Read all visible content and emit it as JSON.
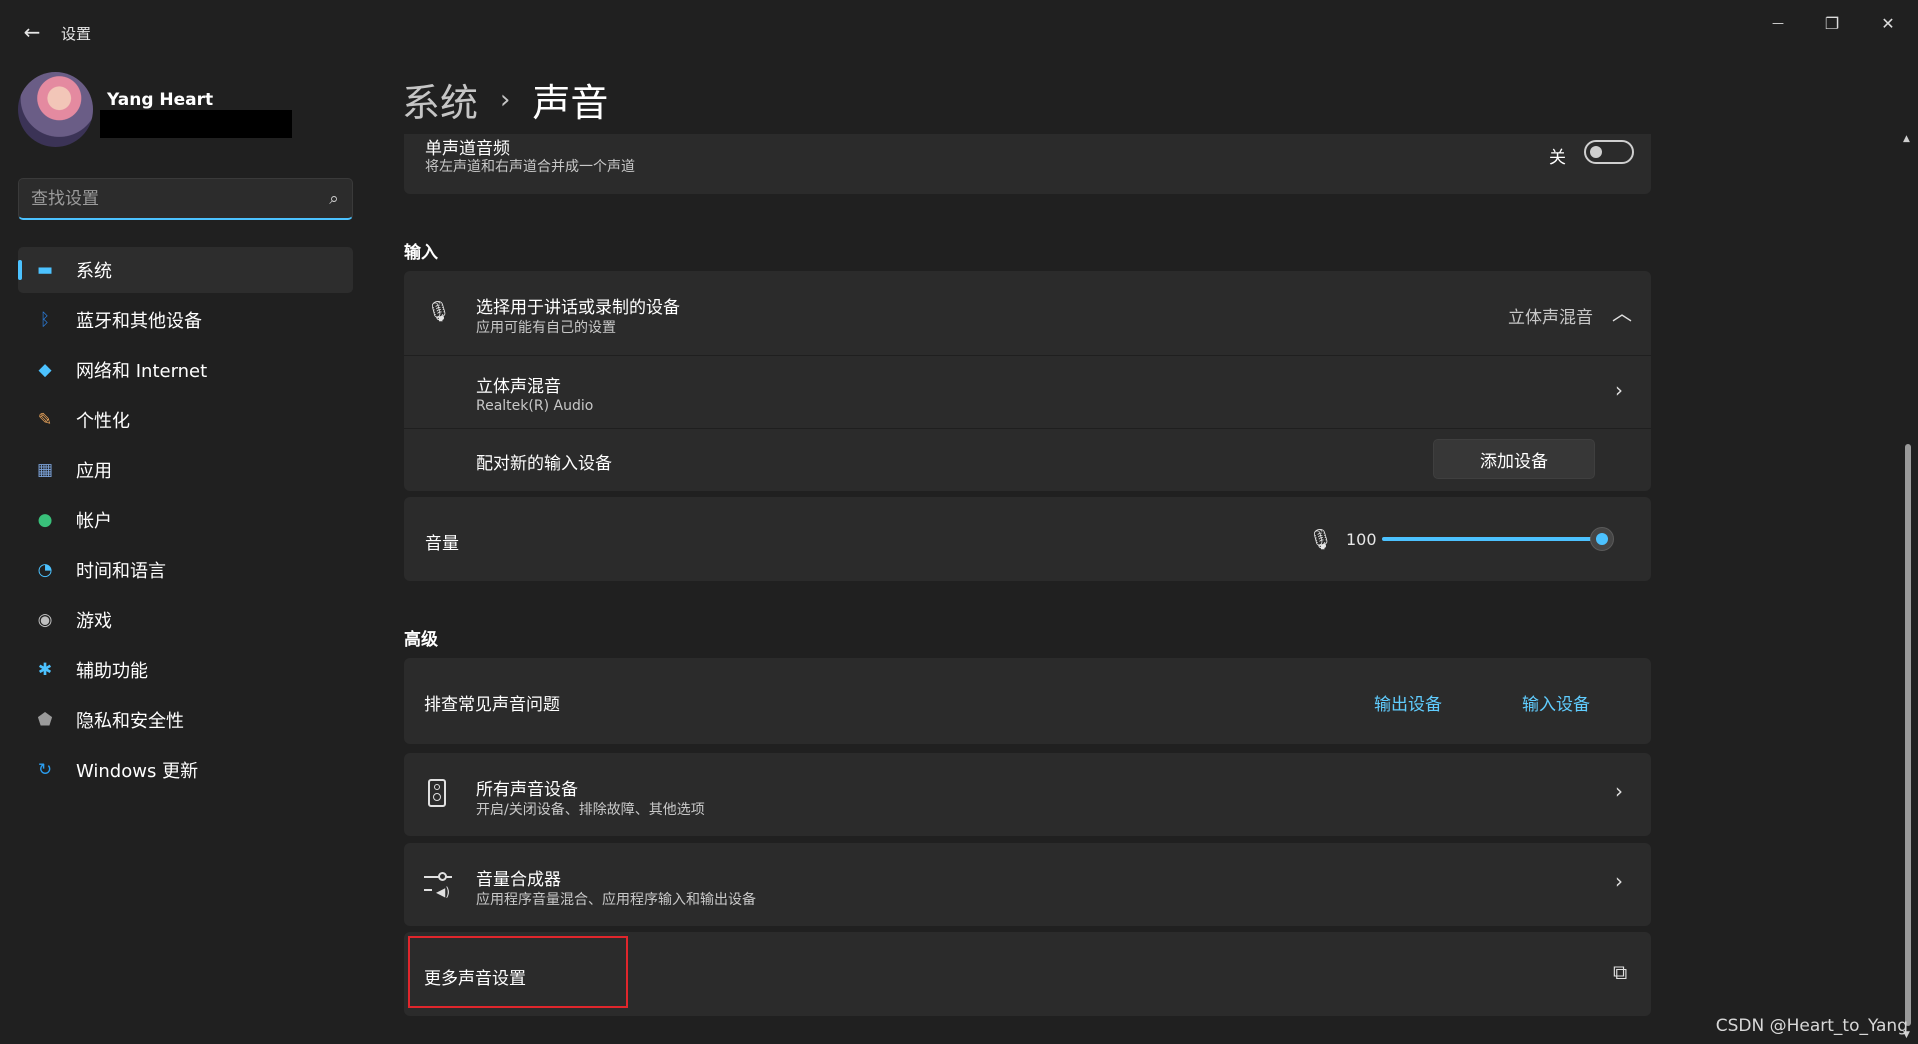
{
  "window": {
    "app_title": "设置",
    "back_icon": "←",
    "minimize_icon": "—",
    "restore_icon": "❐",
    "close_icon": "✕"
  },
  "user": {
    "name": "Yang Heart"
  },
  "search": {
    "placeholder": "查找设置",
    "icon": "⌕"
  },
  "sidebar": {
    "items": [
      {
        "label": "系统",
        "icon": "▬",
        "color": "#4cc2ff",
        "active": true
      },
      {
        "label": "蓝牙和其他设备",
        "icon": "ᛒ",
        "color": "#2b7bd8"
      },
      {
        "label": "网络和 Internet",
        "icon": "◆",
        "color": "#4cc2ff"
      },
      {
        "label": "个性化",
        "icon": "✎",
        "color": "#e8a35a"
      },
      {
        "label": "应用",
        "icon": "▦",
        "color": "#7aa0d6"
      },
      {
        "label": "帐户",
        "icon": "●",
        "color": "#39c07a"
      },
      {
        "label": "时间和语言",
        "icon": "◔",
        "color": "#4cc2ff"
      },
      {
        "label": "游戏",
        "icon": "◉",
        "color": "#bfbfbf"
      },
      {
        "label": "辅助功能",
        "icon": "✱",
        "color": "#4cc2ff"
      },
      {
        "label": "隐私和安全性",
        "icon": "⬟",
        "color": "#9a9a9a"
      },
      {
        "label": "Windows 更新",
        "icon": "↻",
        "color": "#2b9ef0"
      }
    ]
  },
  "header": {
    "parent": "系统",
    "separator": "›",
    "current": "声音"
  },
  "mono_audio": {
    "title": "单声道音频",
    "description": "将左声道和右声道合并成一个声道",
    "state_label": "关"
  },
  "input_section": {
    "title": "输入",
    "choose_device": {
      "title": "选择用于讲话或录制的设备",
      "description": "应用可能有自己的设置",
      "selected": "立体声混音",
      "icon": "🎙",
      "chevron": "︿"
    },
    "device_row": {
      "name": "立体声混音",
      "driver": "Realtek(R) Audio",
      "chevron": "›"
    },
    "pair_row": {
      "label": "配对新的输入设备",
      "button": "添加设备"
    },
    "volume": {
      "label": "音量",
      "value": "100",
      "level": 100,
      "mic_icon": "🎙"
    }
  },
  "advanced_section": {
    "title": "高级",
    "troubleshoot": {
      "label": "排查常见声音问题",
      "link_output": "输出设备",
      "link_input": "输入设备"
    },
    "all_devices": {
      "title": "所有声音设备",
      "description": "开启/关闭设备、排除故障、其他选项",
      "chevron": "›"
    },
    "mixer": {
      "title": "音量合成器",
      "description": "应用程序音量混合、应用程序输入和输出设备",
      "chevron": "›"
    },
    "more_settings": {
      "label": "更多声音设置",
      "external_icon": "⧉"
    }
  },
  "watermark": "CSDN @Heart_to_Yang"
}
